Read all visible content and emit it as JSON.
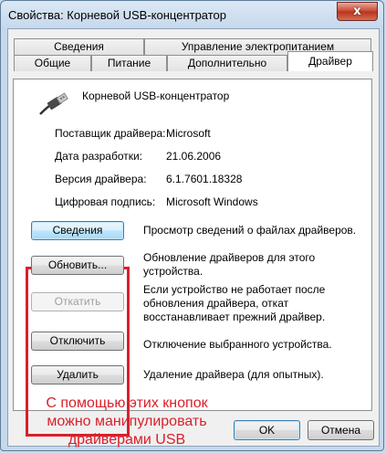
{
  "window": {
    "title": "Свойства: Корневой USB-концентратор",
    "close_glyph": "x"
  },
  "tabs": {
    "row1": [
      {
        "label": "Сведения"
      },
      {
        "label": "Управление электропитанием"
      }
    ],
    "row2": [
      {
        "label": "Общие"
      },
      {
        "label": "Питание"
      },
      {
        "label": "Дополнительно"
      },
      {
        "label": "Драйвер",
        "active": true
      }
    ]
  },
  "driver": {
    "device_icon": "usb-plug-icon",
    "device_name": "Корневой USB-концентратор",
    "info": [
      {
        "label": "Поставщик драйвера:",
        "value": "Microsoft"
      },
      {
        "label": "Дата разработки:",
        "value": "21.06.2006"
      },
      {
        "label": "Версия драйвера:",
        "value": "6.1.7601.18328"
      },
      {
        "label": "Цифровая подпись:",
        "value": "Microsoft Windows"
      }
    ],
    "actions": [
      {
        "button": "Сведения",
        "description": "Просмотр сведений о файлах драйверов."
      },
      {
        "button": "Обновить...",
        "description": "Обновление драйверов для этого устройства."
      },
      {
        "button": "Откатить",
        "description": "Если устройство не работает после обновления драйвера, откат восстанавливает прежний драйвер.",
        "disabled": true
      },
      {
        "button": "Отключить",
        "description": "Отключение выбранного устройства."
      },
      {
        "button": "Удалить",
        "description": "Удаление драйвера (для опытных)."
      }
    ]
  },
  "annotation": {
    "lines": [
      "С помощью этих кнопок",
      "можно манипулировать",
      "драйверами USB"
    ],
    "color": "#d9202a"
  },
  "footer": {
    "ok": "OK",
    "cancel": "Отмена"
  }
}
